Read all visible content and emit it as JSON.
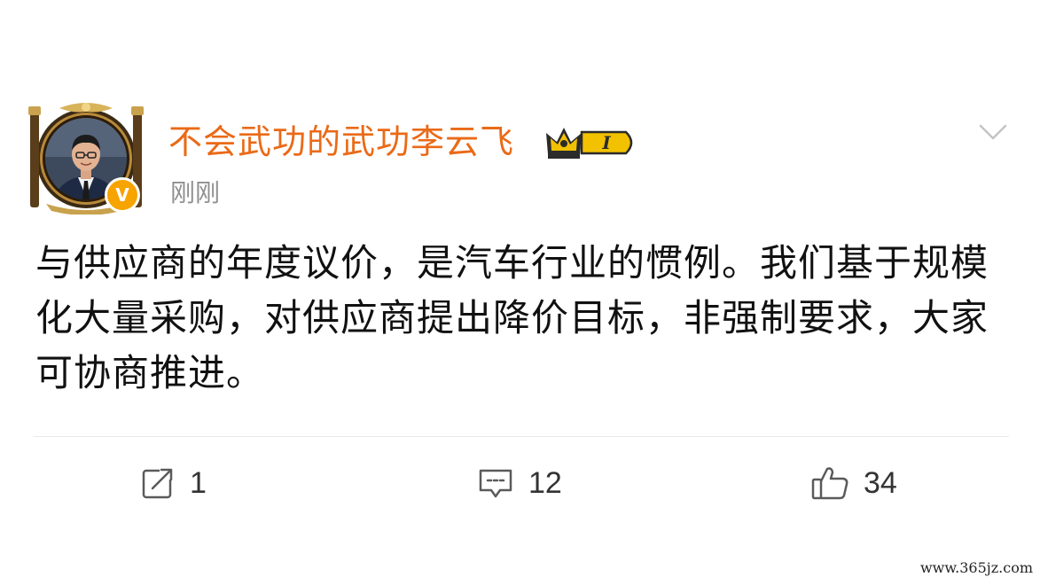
{
  "post": {
    "username": "不会武功的武功李云飞",
    "timestamp": "刚刚",
    "verified_badge": "V",
    "level_badge": "I",
    "text": "与供应商的年度议价，是汽车行业的惯例。我们基于规模化大量采购，对供应商提出降价目标，非强制要求，大家可协商推进。",
    "icons": {
      "more": "chevron-down-icon",
      "repost": "repost-icon",
      "comment": "comment-icon",
      "like": "thumbs-up-icon",
      "level": "crown-level-icon"
    }
  },
  "actions": {
    "repost_count": "1",
    "comment_count": "12",
    "like_count": "34"
  },
  "watermark": "www.365jz.com",
  "colors": {
    "username": "#ea6a17",
    "verified": "#f7a300",
    "timestamp": "#8f8f8f",
    "icon": "#5a5a5a"
  }
}
